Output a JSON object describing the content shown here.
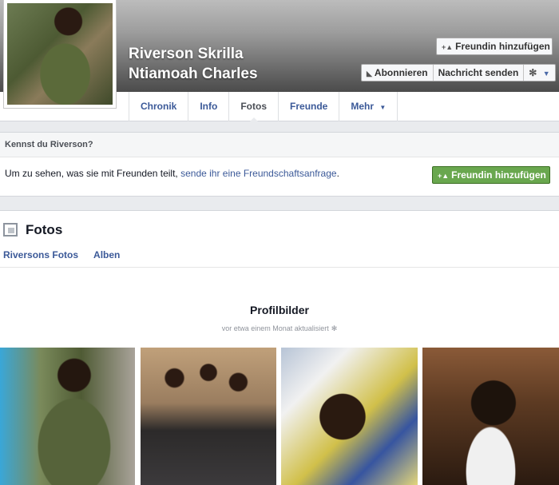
{
  "header": {
    "name_line1": "Riverson Skrilla",
    "name_line2": "Ntiamoah Charles",
    "add_friend_label": "Freundin hinzufügen",
    "subscribe_label": "Abonnieren",
    "message_label": "Nachricht senden"
  },
  "tabs": [
    {
      "label": "Chronik"
    },
    {
      "label": "Info"
    },
    {
      "label": "Fotos"
    },
    {
      "label": "Freunde"
    },
    {
      "label": "Mehr"
    }
  ],
  "know": {
    "heading": "Kennst du Riverson?",
    "text": "Um zu sehen, was sie mit Freunden teilt,",
    "link": "sende ihr eine Freundschaftsanfrage",
    "text_end": ".",
    "button_label": "Freundin hinzufügen"
  },
  "fotos": {
    "title": "Fotos",
    "subnav": [
      "Riversons Fotos",
      "Alben"
    ],
    "album_title": "Profilbilder",
    "album_subtitle": "vor etwa einem Monat aktualisiert"
  },
  "icons": {
    "add_friend": "add-friend-icon",
    "subscribe": "rss-icon",
    "settings": "gear-icon",
    "dropdown": "chevron-down-icon",
    "photos": "photos-icon"
  },
  "colors": {
    "link": "#3b5998",
    "green_button": "#69a74e"
  }
}
